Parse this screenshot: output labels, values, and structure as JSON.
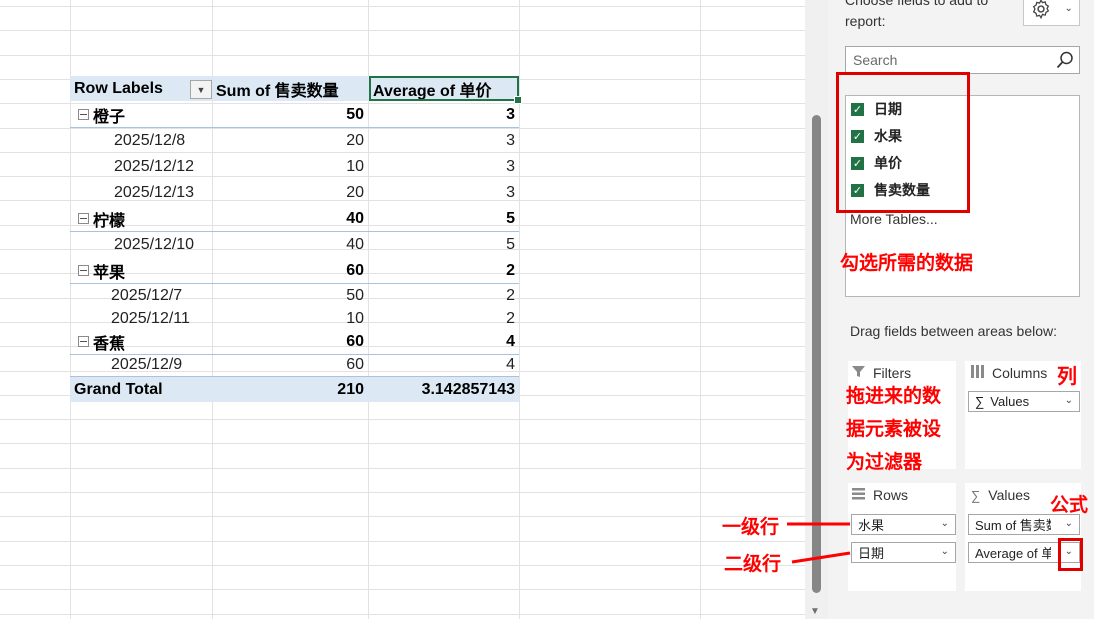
{
  "pivot": {
    "headers": {
      "row_labels": "Row Labels",
      "sum_col": "Sum of 售卖数量",
      "avg_col": "Average of 单价"
    },
    "groups": [
      {
        "name": "橙子",
        "sum": "50",
        "avg": "3",
        "items": [
          {
            "date": "2025/12/8",
            "sum": "20",
            "avg": "3"
          },
          {
            "date": "2025/12/12",
            "sum": "10",
            "avg": "3"
          },
          {
            "date": "2025/12/13",
            "sum": "20",
            "avg": "3"
          }
        ]
      },
      {
        "name": "柠檬",
        "sum": "40",
        "avg": "5",
        "items": [
          {
            "date": "2025/12/10",
            "sum": "40",
            "avg": "5"
          }
        ]
      },
      {
        "name": "苹果",
        "sum": "60",
        "avg": "2",
        "items": [
          {
            "date": "2025/12/7",
            "sum": "50",
            "avg": "2"
          },
          {
            "date": "2025/12/11",
            "sum": "10",
            "avg": "2"
          }
        ]
      },
      {
        "name": "香蕉",
        "sum": "60",
        "avg": "4",
        "items": [
          {
            "date": "2025/12/9",
            "sum": "60",
            "avg": "4"
          }
        ]
      }
    ],
    "grand_total": {
      "label": "Grand Total",
      "sum": "210",
      "avg": "3.142857143"
    }
  },
  "panel": {
    "choose_label": "Choose fields to add to report:",
    "search_placeholder": "Search",
    "fields": [
      {
        "label": "日期",
        "checked": true
      },
      {
        "label": "水果",
        "checked": true
      },
      {
        "label": "单价",
        "checked": true
      },
      {
        "label": "售卖数量",
        "checked": true
      }
    ],
    "more_tables": "More Tables...",
    "drag_label": "Drag fields between areas below:",
    "areas": {
      "filters": {
        "title": "Filters"
      },
      "columns": {
        "title": "Columns",
        "items": [
          "Values"
        ]
      },
      "rows": {
        "title": "Rows",
        "items": [
          "水果",
          "日期"
        ]
      },
      "values": {
        "title": "Values",
        "items": [
          "Sum of 售卖数量",
          "Average of 单价"
        ]
      }
    }
  },
  "annotations": {
    "select_data": "勾选所需的数据",
    "filter_note": [
      "拖进来的数",
      "据元素被设",
      "为过滤器"
    ],
    "columns_note": "列",
    "formula_note": "公式",
    "level1": "一级行",
    "level2": "二级行"
  },
  "colors": {
    "accent": "#217346",
    "header_fill": "#dce9f5",
    "annotation_red": "#ff0000"
  }
}
